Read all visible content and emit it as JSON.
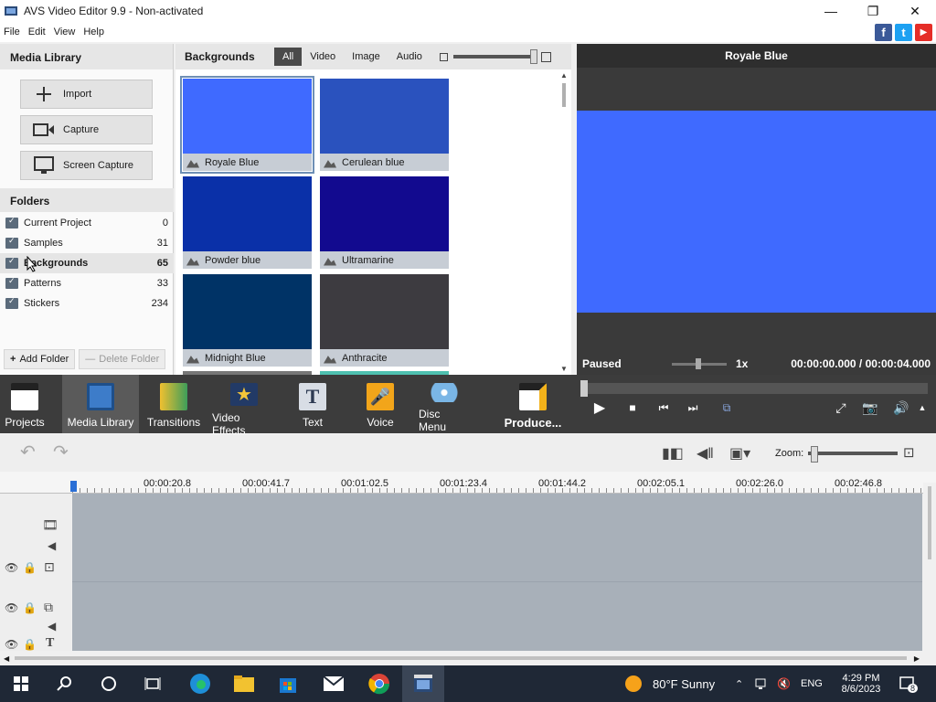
{
  "window": {
    "title": "AVS Video Editor 9.9 - Non-activated",
    "minimize": "—",
    "maximize": "❐",
    "close": "✕"
  },
  "menu": [
    "File",
    "Edit",
    "View",
    "Help"
  ],
  "social": {
    "facebook": "f",
    "twitter": "t",
    "youtube": "▶"
  },
  "media_library": {
    "title": "Media Library",
    "buttons": [
      "Import",
      "Capture",
      "Screen Capture"
    ]
  },
  "folders": {
    "title": "Folders",
    "items": [
      {
        "name": "Current Project",
        "count": "0"
      },
      {
        "name": "Samples",
        "count": "31"
      },
      {
        "name": "Backgrounds",
        "count": "65"
      },
      {
        "name": "Patterns",
        "count": "33"
      },
      {
        "name": "Stickers",
        "count": "234"
      }
    ],
    "add_label": "Add Folder",
    "delete_label": "Delete Folder"
  },
  "backgrounds": {
    "title": "Backgrounds",
    "filters": [
      "All",
      "Video",
      "Image",
      "Audio"
    ],
    "active_filter": "All",
    "items": [
      {
        "name": "Royale Blue",
        "color": "#3f6aff"
      },
      {
        "name": "Cerulean blue",
        "color": "#2a52be"
      },
      {
        "name": "Powder blue",
        "color": "#0a30a8"
      },
      {
        "name": "Ultramarine",
        "color": "#120a8f"
      },
      {
        "name": "Midnight Blue",
        "color": "#003366"
      },
      {
        "name": "Anthracite",
        "color": "#3d3b40"
      }
    ]
  },
  "preview": {
    "title": "Royale Blue",
    "frame_color": "#3f6aff",
    "status": "Paused",
    "speed": "1x",
    "current_time": "00:00:00.000",
    "total_time": "00:00:04.000",
    "separator": "/"
  },
  "toolbar": {
    "items": [
      "Projects",
      "Media Library",
      "Transitions",
      "Video Effects",
      "Text",
      "Voice",
      "Disc Menu"
    ],
    "active": "Media Library",
    "produce": "Produce..."
  },
  "timeline": {
    "zoom_label": "Zoom:",
    "ticks": [
      "00:00:20.8",
      "00:00:41.7",
      "00:01:02.5",
      "00:01:23.4",
      "00:01:44.2",
      "00:02:05.1",
      "00:02:26.0",
      "00:02:46.8"
    ]
  },
  "taskbar": {
    "weather": "80°F  Sunny",
    "lang": "ENG",
    "time": "4:29 PM",
    "date": "8/6/2023",
    "notifications": "8"
  }
}
